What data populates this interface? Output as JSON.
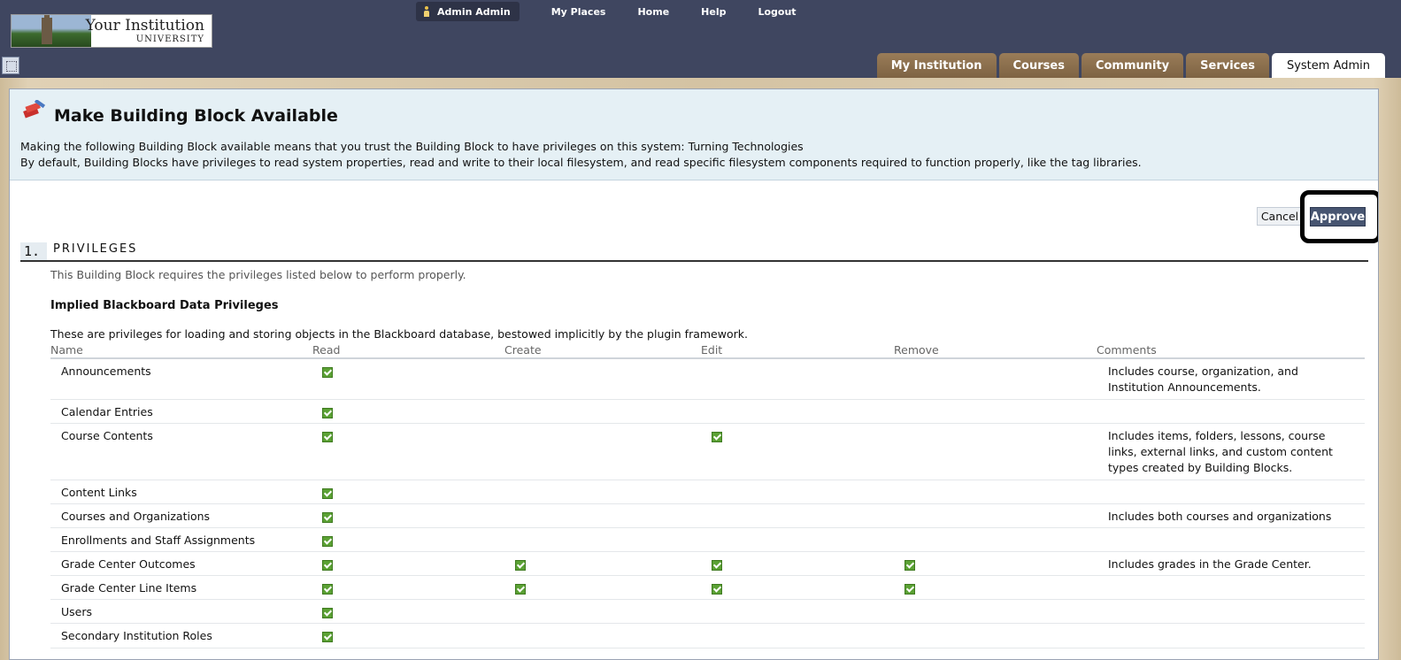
{
  "logo": {
    "line1": "Your Institution",
    "line2": "UNIVERSITY"
  },
  "user_nav": {
    "user": "Admin Admin",
    "links": [
      "My Places",
      "Home",
      "Help",
      "Logout"
    ]
  },
  "tabs": [
    "My Institution",
    "Courses",
    "Community",
    "Services",
    "System Admin"
  ],
  "active_tab": "System Admin",
  "page": {
    "title": "Make Building Block Available",
    "description_1": "Making the following Building Block available means that you trust the Building Block to have privileges on this system: Turning Technologies",
    "description_2": "By default, Building Blocks have privileges to read system properties, read and write to their local filesystem, and read specific filesystem components required to function properly, like the tag libraries."
  },
  "actions": {
    "cancel": "Cancel",
    "approve": "Approve"
  },
  "step": {
    "number": "1.",
    "title": "PRIVILEGES",
    "intro": "This Building Block requires the privileges listed below to perform properly.",
    "subtitle": "Implied Blackboard Data Privileges",
    "subdesc": "These are privileges for loading and storing objects in the Blackboard database, bestowed implicitly by the plugin framework."
  },
  "table": {
    "headers": {
      "name": "Name",
      "read": "Read",
      "create": "Create",
      "edit": "Edit",
      "remove": "Remove",
      "comments": "Comments"
    },
    "rows": [
      {
        "name": "Announcements",
        "read": true,
        "create": false,
        "edit": false,
        "remove": false,
        "comment": "Includes course, organization, and Institution Announcements."
      },
      {
        "name": "Calendar Entries",
        "read": true,
        "create": false,
        "edit": false,
        "remove": false,
        "comment": ""
      },
      {
        "name": "Course Contents",
        "read": true,
        "create": false,
        "edit": true,
        "remove": false,
        "comment": "Includes items, folders, lessons, course links, external links, and custom content types created by Building Blocks."
      },
      {
        "name": "Content Links",
        "read": true,
        "create": false,
        "edit": false,
        "remove": false,
        "comment": ""
      },
      {
        "name": "Courses and Organizations",
        "read": true,
        "create": false,
        "edit": false,
        "remove": false,
        "comment": "Includes both courses and organizations"
      },
      {
        "name": "Enrollments and Staff Assignments",
        "read": true,
        "create": false,
        "edit": false,
        "remove": false,
        "comment": ""
      },
      {
        "name": "Grade Center Outcomes",
        "read": true,
        "create": true,
        "edit": true,
        "remove": true,
        "comment": "Includes grades in the Grade Center."
      },
      {
        "name": "Grade Center Line Items",
        "read": true,
        "create": true,
        "edit": true,
        "remove": true,
        "comment": ""
      },
      {
        "name": "Users",
        "read": true,
        "create": false,
        "edit": false,
        "remove": false,
        "comment": ""
      },
      {
        "name": "Secondary Institution Roles",
        "read": true,
        "create": false,
        "edit": false,
        "remove": false,
        "comment": ""
      }
    ]
  },
  "colors": {
    "topbar": "#3f4660",
    "tab": "#8a6d4c",
    "header_bg": "#e5f0f5",
    "approve": "#475571",
    "check": "#5ba134"
  }
}
